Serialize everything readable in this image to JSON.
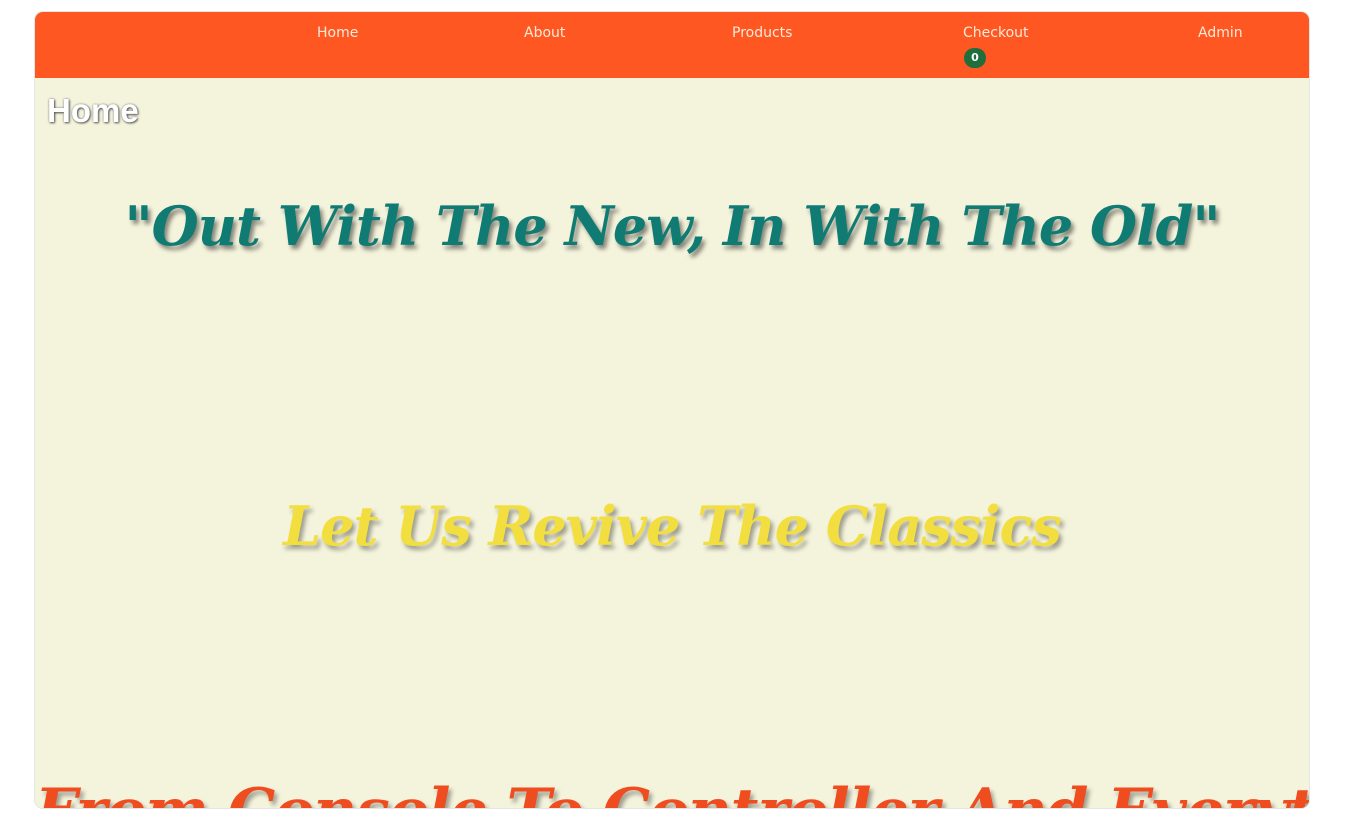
{
  "navbar": {
    "links": [
      "Home",
      "About",
      "Products",
      "Checkout",
      "Admin"
    ],
    "cart_count": "0",
    "background_color": "#ff5722"
  },
  "page": {
    "heading": "Home",
    "background_color": "#f4f3dc"
  },
  "hero": {
    "line1": "\"Out With The New, In With The Old\"",
    "line1_color": "#0f7b72",
    "line2": "Let Us Revive The Classics",
    "line2_color": "#f2df3f",
    "line3": "From Console To Controller And Everything In Between",
    "line3_color": "#ef4d20"
  }
}
